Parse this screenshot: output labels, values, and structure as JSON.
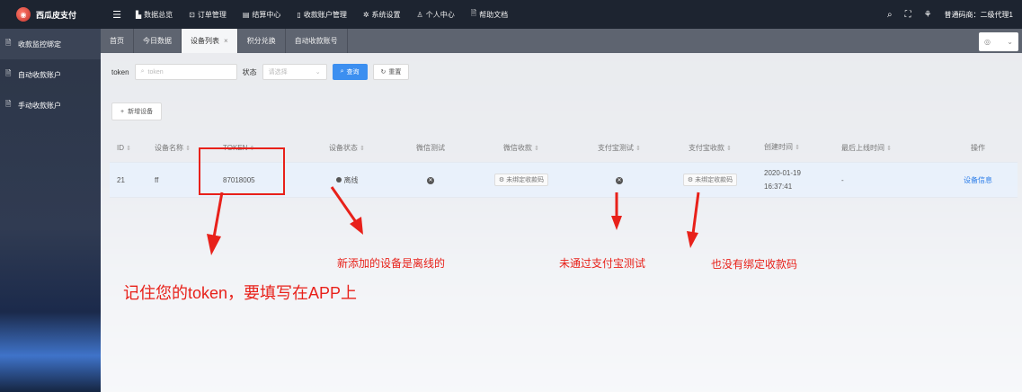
{
  "brand": {
    "name": "西瓜皮支付"
  },
  "nav": [
    {
      "label": "数据总览",
      "icon": "chart-icon",
      "glyph": "▙"
    },
    {
      "label": "订单管理",
      "icon": "cart-icon",
      "glyph": "⊡"
    },
    {
      "label": "结算中心",
      "icon": "calendar-icon",
      "glyph": "▤"
    },
    {
      "label": "收款账户管理",
      "icon": "phone-icon",
      "glyph": "▯"
    },
    {
      "label": "系统设置",
      "icon": "gear-icon",
      "glyph": "✲"
    },
    {
      "label": "个人中心",
      "icon": "user-icon",
      "glyph": "♙"
    },
    {
      "label": "帮助文档",
      "icon": "document-icon",
      "glyph": "🗎"
    }
  ],
  "topright": {
    "user_label": "普通码商：二级代理1"
  },
  "sidebar": [
    {
      "label": "收款监控绑定",
      "active": true
    },
    {
      "label": "自动收款账户",
      "active": false
    },
    {
      "label": "手动收款账户",
      "active": false
    }
  ],
  "tabs": [
    {
      "label": "首页"
    },
    {
      "label": "今日数据"
    },
    {
      "label": "设备列表",
      "active": true,
      "close": "×"
    },
    {
      "label": "积分兑换"
    },
    {
      "label": "自动收款账号"
    }
  ],
  "filter": {
    "token_label": "token",
    "token_placeholder": "token",
    "status_label": "状态",
    "status_placeholder": "请选择",
    "search_btn": "查询",
    "reset_btn": "重置"
  },
  "add_btn": "新增设备",
  "table": {
    "headers": [
      "ID",
      "设备名称",
      "TOKEN",
      "设备状态",
      "微信测试",
      "微信收款",
      "支付宝测试",
      "支付宝收款",
      "创建时间",
      "最后上线时间",
      "操作"
    ],
    "row": {
      "id": "21",
      "name": "ff",
      "token": "87018005",
      "status": "离线",
      "wechat_receive": "未绑定收款码",
      "alipay_receive": "未绑定收款码",
      "created": "2020-01-19 16:37:41",
      "last_online": "-",
      "action": "设备信息"
    }
  },
  "annotations": {
    "token_note": "记住您的token，要填写在APP上",
    "offline_note": "新添加的设备是离线的",
    "alipay_test_note": "未通过支付宝测试",
    "alipay_code_note": "也没有绑定收款码"
  },
  "colors": {
    "accent": "#3c8ff0",
    "annotation": "#e8211a",
    "topbar": "#1d2430"
  }
}
